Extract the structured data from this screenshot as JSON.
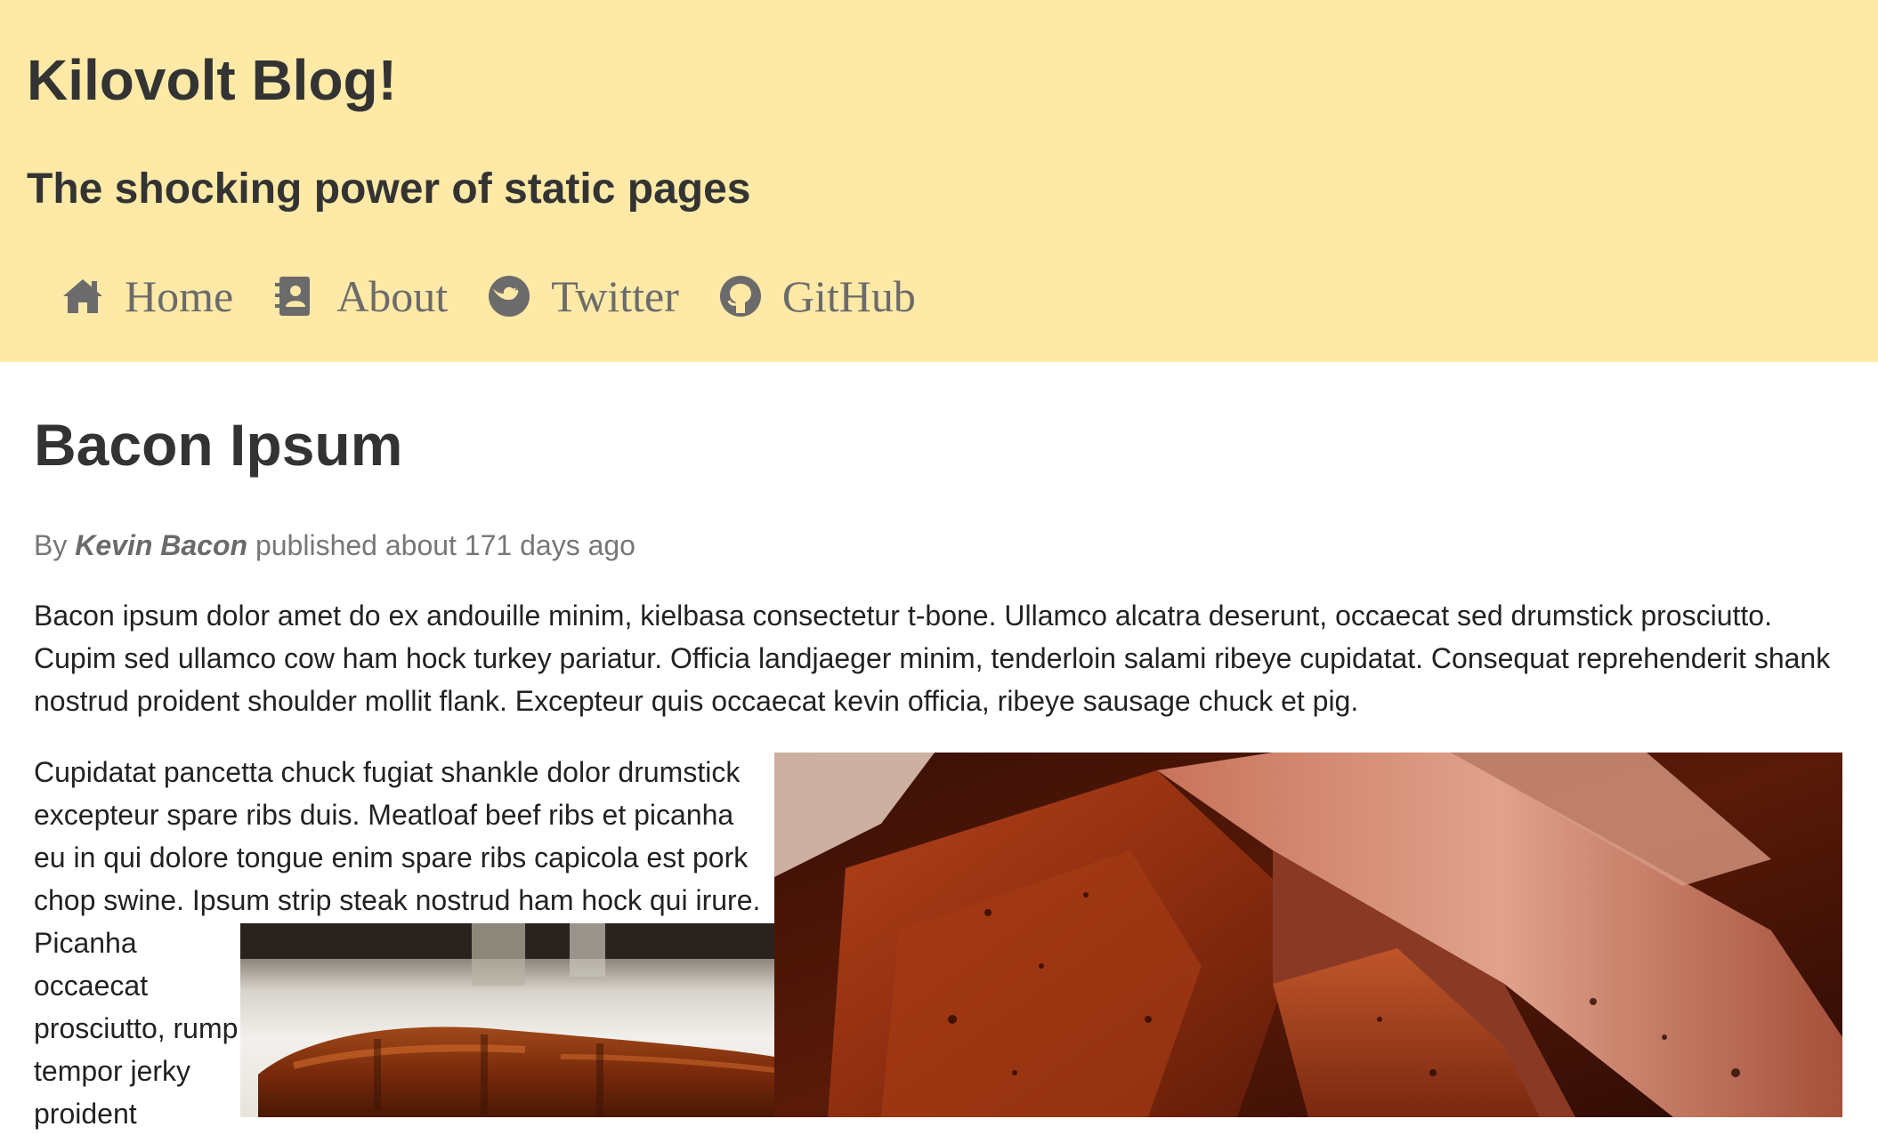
{
  "site": {
    "title": "Kilovolt Blog!",
    "tagline": "The shocking power of static pages"
  },
  "nav": {
    "items": [
      {
        "label": "Home",
        "icon": "home-icon"
      },
      {
        "label": "About",
        "icon": "address-book-icon"
      },
      {
        "label": "Twitter",
        "icon": "twitter-icon"
      },
      {
        "label": "GitHub",
        "icon": "github-icon"
      }
    ]
  },
  "post": {
    "title": "Bacon Ipsum",
    "byline_prefix": "By ",
    "author": "Kevin Bacon",
    "byline_suffix": " published about 171 days ago",
    "paragraph1": "Bacon ipsum dolor amet do ex andouille minim, kielbasa consectetur t-bone. Ullamco alcatra deserunt, occaecat sed drumstick prosciutto. Cupim sed ullamco cow ham hock turkey pariatur. Officia landjaeger minim, tenderloin salami ribeye cupidatat. Consequat reprehenderit shank nostrud proident shoulder mollit flank. Excepteur quis occaecat kevin officia, ribeye sausage chuck et pig.",
    "paragraph2_top": "Cupidatat pancetta chuck fugiat shankle dolor drumstick excepteur spare ribs duis. Meatloaf beef ribs et picanha eu in qui dolore tongue enim spare ribs capicola est pork chop swine. Ipsum strip steak nostrud ham hock qui irure.",
    "paragraph2_narrow": "Picanha occaecat prosciutto, rump tempor jerky proident"
  },
  "colors": {
    "header_bg": "#ffe9a6",
    "nav_text": "#6b6b6b",
    "heading": "#333333",
    "byline": "#777777"
  }
}
